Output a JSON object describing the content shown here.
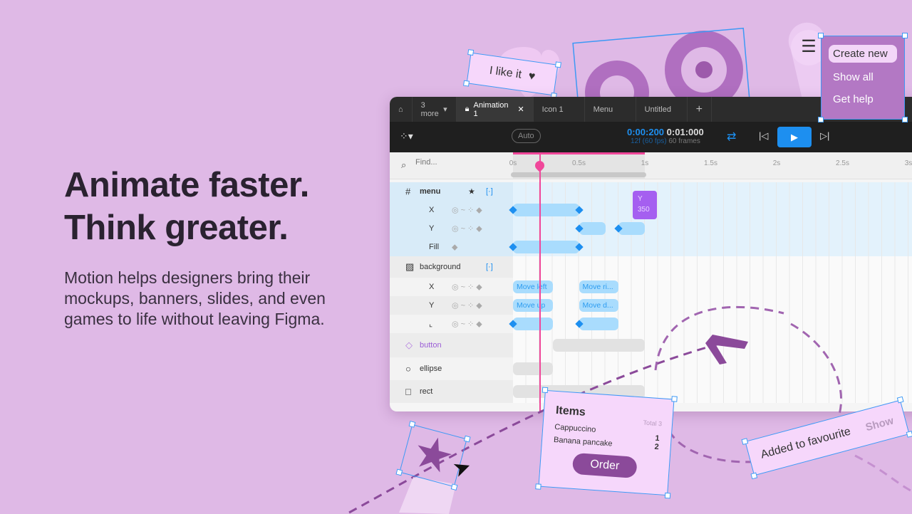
{
  "hero": {
    "title_line1": "Animate faster.",
    "title_line2": "Think greater.",
    "body": "Motion helps designers bring their mockups, banners, slides, and even games to life without leaving Figma."
  },
  "colors": {
    "background": "#dfb9e6",
    "accent_blue": "#1d8ff0",
    "playhead": "#f0479a",
    "purple": "#8b4a9a"
  },
  "tabs": [
    {
      "label": "3 more",
      "icon": "chevron-down-icon"
    },
    {
      "label": "Animation 1",
      "icon": "lock-icon",
      "active": true
    },
    {
      "label": "Icon 1"
    },
    {
      "label": "Menu"
    },
    {
      "label": "Untitled"
    }
  ],
  "toolbar": {
    "auto_label": "Auto",
    "current_time": "0:00:200",
    "total_time": "0:01:000",
    "frame_info": "12f (60 fps)",
    "frames": "60 frames"
  },
  "search": {
    "placeholder": "Find..."
  },
  "timeline": {
    "ticks": [
      "0s",
      "0.5s",
      "1s",
      "1.5s",
      "2s",
      "2.5s",
      "3s"
    ],
    "playhead_s": 0.2,
    "range_end_s": 1.0,
    "tooltip": {
      "label": "Y",
      "value": "350"
    },
    "rows": [
      {
        "name": "menu",
        "icon": "hash",
        "level": 0,
        "group": "menu",
        "bold": true,
        "bars": []
      },
      {
        "name": "X",
        "level": 1,
        "group": "menu",
        "bars": [
          {
            "start": 0,
            "end": 0.5,
            "kf": [
              0,
              0.5
            ]
          }
        ]
      },
      {
        "name": "Y",
        "level": 1,
        "group": "menu",
        "bars": [
          {
            "start": 0.5,
            "end": 0.7,
            "kf": [
              0.5
            ]
          },
          {
            "start": 0.8,
            "end": 1.0,
            "kf": [
              0.8
            ]
          }
        ]
      },
      {
        "name": "Fill",
        "level": 1,
        "group": "menu",
        "bars": [
          {
            "start": 0,
            "end": 0.5,
            "kf": [
              0,
              0.5
            ]
          }
        ]
      },
      {
        "name": "background",
        "icon": "image",
        "level": 0,
        "bars": []
      },
      {
        "name": "X",
        "level": 1,
        "bars": [
          {
            "start": 0,
            "end": 0.3,
            "label": "Move left"
          },
          {
            "start": 0.5,
            "end": 0.8,
            "label": "Move ri..."
          }
        ]
      },
      {
        "name": "Y",
        "level": 1,
        "bars": [
          {
            "start": 0,
            "end": 0.3,
            "label": "Move up"
          },
          {
            "start": 0.5,
            "end": 0.8,
            "label": "Move d..."
          }
        ]
      },
      {
        "name": "⌞",
        "level": 1,
        "bars": [
          {
            "start": 0,
            "end": 0.3,
            "kf": [
              0
            ]
          },
          {
            "start": 0.5,
            "end": 0.8,
            "kf": [
              0.5
            ]
          }
        ]
      },
      {
        "name": "button",
        "icon": "component",
        "level": 0,
        "purple": true,
        "bars": [
          {
            "start": 0.3,
            "end": 1.0,
            "gray": true
          }
        ]
      },
      {
        "name": "ellipse",
        "icon": "circle",
        "level": 0,
        "bars": [
          {
            "start": 0,
            "end": 0.3,
            "gray": true
          }
        ]
      },
      {
        "name": "rect",
        "icon": "square",
        "level": 0,
        "bars": [
          {
            "start": 0,
            "end": 1.0,
            "gray": true
          }
        ]
      }
    ]
  },
  "like_card": {
    "label": "I like it"
  },
  "menu_popup": {
    "items": [
      "Create new",
      "Show all",
      "Get help"
    ]
  },
  "items_card": {
    "title": "Items",
    "total": "Total 3",
    "items": [
      {
        "name": "Cappuccino",
        "qty": "1"
      },
      {
        "name": "Banana pancake",
        "qty": "2"
      }
    ],
    "button": "Order"
  },
  "toast": {
    "label": "Added to favourite",
    "action": "Show"
  }
}
